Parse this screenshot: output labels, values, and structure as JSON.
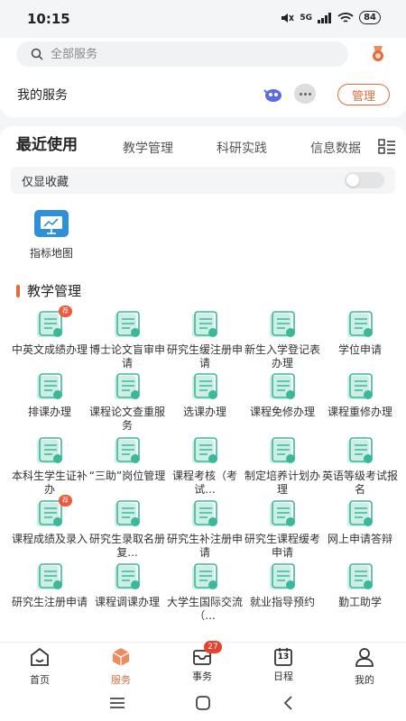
{
  "status": {
    "time": "10:15",
    "network": "5G",
    "battery": "84"
  },
  "search": {
    "placeholder": "全部服务"
  },
  "my_service": {
    "title": "我的服务",
    "manage_label": "管理"
  },
  "tabs": [
    {
      "label": "最近使用",
      "active": true
    },
    {
      "label": "教学管理",
      "active": false
    },
    {
      "label": "科研实践",
      "active": false
    },
    {
      "label": "信息数据",
      "active": false
    }
  ],
  "favorites_toggle": {
    "label": "仅显收藏",
    "on": false
  },
  "recent_items": [
    {
      "label": "指标地图"
    }
  ],
  "section": {
    "title": "教学管理"
  },
  "services": [
    {
      "label": "中英文成绩办理",
      "icon": "translate-icon",
      "recommend": "荐"
    },
    {
      "label": "博士论文盲审申请",
      "icon": "thesis-review-icon"
    },
    {
      "label": "研究生缓注册申请",
      "icon": "user-pause-icon"
    },
    {
      "label": "新生入学登记表办理",
      "icon": "register-form-icon"
    },
    {
      "label": "学位申请",
      "icon": "degree-book-icon"
    },
    {
      "label": "排课办理",
      "icon": "calendar-icon"
    },
    {
      "label": "课程论文查重服务",
      "icon": "document-search-icon"
    },
    {
      "label": "选课办理",
      "icon": "course-select-icon"
    },
    {
      "label": "课程免修办理",
      "icon": "book-exempt-icon"
    },
    {
      "label": "课程重修办理",
      "icon": "course-retake-icon"
    },
    {
      "label": "本科生学生证补办",
      "icon": "student-card-icon"
    },
    {
      "label": "“三助”岗位管理",
      "icon": "position-icon"
    },
    {
      "label": "课程考核（考试...",
      "icon": "exam-icon"
    },
    {
      "label": "制定培养计划办理",
      "icon": "training-plan-icon"
    },
    {
      "label": "英语等级考试报名",
      "icon": "cet-icon"
    },
    {
      "label": "课程成绩及录入",
      "icon": "grade-entry-icon",
      "recommend": "荐"
    },
    {
      "label": "研究生录取名册复...",
      "icon": "printer-icon"
    },
    {
      "label": "研究生补注册申请",
      "icon": "graduate-add-icon"
    },
    {
      "label": "研究生课程缓考申请",
      "icon": "book-clock-icon"
    },
    {
      "label": "网上申请答辩",
      "icon": "online-defense-icon"
    },
    {
      "label": "研究生注册申请",
      "icon": "graduate-register-icon"
    },
    {
      "label": "课程调课办理",
      "icon": "course-adjust-icon"
    },
    {
      "label": "大学生国际交流（...",
      "icon": "globe-icon"
    },
    {
      "label": "就业指导预约",
      "icon": "briefcase-icon"
    },
    {
      "label": "勤工助学",
      "icon": "work-study-icon"
    }
  ],
  "bottom_nav": [
    {
      "label": "首页",
      "icon": "home-icon"
    },
    {
      "label": "服务",
      "icon": "service-cube-icon",
      "active": true
    },
    {
      "label": "事务",
      "icon": "tray-icon",
      "badge": "27"
    },
    {
      "label": "日程",
      "icon": "calendar-13-icon",
      "day": "13"
    },
    {
      "label": "我的",
      "icon": "profile-icon"
    }
  ],
  "colors": {
    "accent": "#e06c3e",
    "icon_green": "#3bb89a",
    "icon_light": "#cdeee5"
  }
}
